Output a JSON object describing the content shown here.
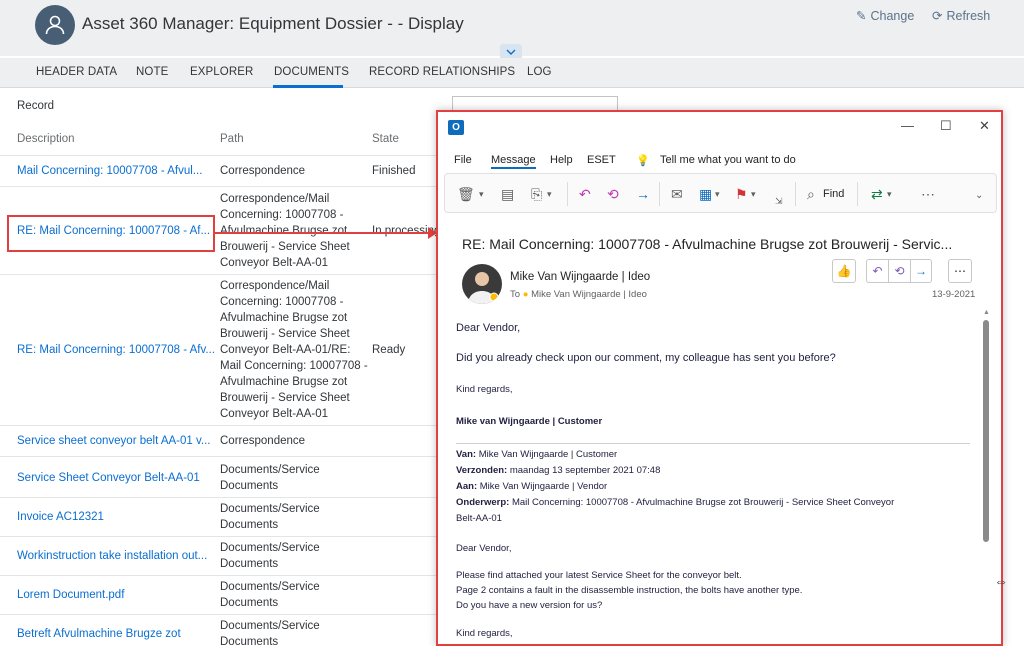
{
  "header": {
    "title": "Asset 360 Manager: Equipment Dossier - - Display",
    "change_label": "Change",
    "refresh_label": "Refresh"
  },
  "tabs": [
    "HEADER DATA",
    "NOTE",
    "EXPLORER",
    "DOCUMENTS",
    "RECORD RELATIONSHIPS",
    "LOG"
  ],
  "table": {
    "record_label": "Record",
    "columns": {
      "description": "Description",
      "path": "Path",
      "state": "State"
    },
    "rows": [
      {
        "description": "Mail Concerning: 10007708 - Afvul...",
        "path": "Correspondence",
        "state": "Finished"
      },
      {
        "description": "RE: Mail Concerning: 10007708 - Af...",
        "path": "Correspondence/Mail Concerning: 10007708 - Afvulmachine Brugse zot Brouwerij - Service Sheet Conveyor Belt-AA-01",
        "state": "In processing"
      },
      {
        "description": "RE: Mail Concerning: 10007708 - Afv...",
        "path": "Correspondence/Mail Concerning: 10007708 - Afvulmachine Brugse zot Brouwerij - Service Sheet Conveyor Belt-AA-01/RE: Mail Concerning: 10007708 - Afvulmachine Brugse zot Brouwerij - Service Sheet Conveyor Belt-AA-01",
        "state": "Ready"
      },
      {
        "description": "Service sheet conveyor belt AA-01 v...",
        "path": "Correspondence",
        "state": ""
      },
      {
        "description": "Service Sheet Conveyor Belt-AA-01",
        "path": "Documents/Service Documents",
        "state": ""
      },
      {
        "description": "Invoice AC12321",
        "path": "Documents/Service Documents",
        "state": ""
      },
      {
        "description": "Workinstruction take installation out...",
        "path": "Documents/Service Documents",
        "state": ""
      },
      {
        "description": "Lorem Document.pdf",
        "path": "Documents/Service Documents",
        "state": ""
      },
      {
        "description": "Betreft Afvulmachine Brugze zot",
        "path": "Documents/Service Documents",
        "state": ""
      }
    ]
  },
  "outlook": {
    "menu": [
      "File",
      "Message",
      "Help",
      "ESET"
    ],
    "tell_me": "Tell me what you want to do",
    "find_label": "Find",
    "subject": "RE: Mail Concerning: 10007708 - Afvulmachine Brugse zot Brouwerij - Servic...",
    "sender": "Mike Van Wijngaarde | Ideo",
    "to_label": "To",
    "to_value": "Mike Van Wijngaarde | Ideo",
    "date": "13-9-2021",
    "body": {
      "greeting": "Dear Vendor,",
      "line1": "Did you already check upon our comment, my colleague has sent you before?",
      "regards": "Kind regards,",
      "signature": "Mike van Wijngaarde | Customer",
      "van_label": "Van:",
      "van_value": "Mike Van Wijngaarde | Customer",
      "verzonden_label": "Verzonden:",
      "verzonden_value": "maandag 13 september 2021 07:48",
      "aan_label": "Aan:",
      "aan_value": "Mike Van Wijngaarde | Vendor",
      "onderwerp_label": "Onderwerp:",
      "onderwerp_value": "Mail Concerning: 10007708 - Afvulmachine Brugse zot Brouwerij - Service Sheet Conveyor",
      "onderwerp_cont": "Belt-AA-01",
      "greeting2": "Dear Vendor,",
      "p1": "Please find attached your latest Service Sheet for the conveyor belt.",
      "p2": "Page 2 contains a fault in the disassemble instruction, the bolts have another type.",
      "p3": "Do you have a new version for us?",
      "regards2": "Kind regards,"
    }
  },
  "colors": {
    "accent": "#0a6ed1",
    "highlight": "#e0403f",
    "outlook_blue": "#0f6cbd"
  }
}
